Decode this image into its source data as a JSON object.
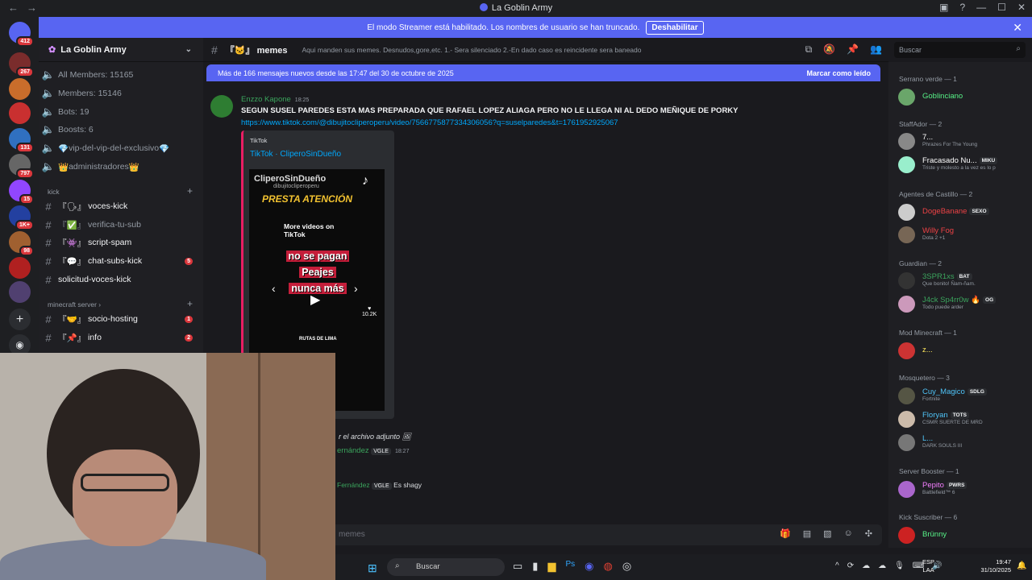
{
  "window": {
    "title": "La Goblin Army",
    "nav_back": "←",
    "nav_fwd": "→"
  },
  "banner": {
    "text": "El modo Streamer está habilitado. Los nombres de usuario se han truncado.",
    "button": "Deshabilitar",
    "close": "✕"
  },
  "servers": [
    {
      "badge": "412"
    },
    {
      "badge": "267"
    },
    {
      "badge": ""
    },
    {
      "badge": ""
    },
    {
      "badge": "131"
    },
    {
      "badge": "797"
    },
    {
      "badge": "15"
    },
    {
      "badge": "1K+"
    },
    {
      "badge": "98"
    },
    {
      "badge": ""
    },
    {
      "badge": ""
    }
  ],
  "sidebar": {
    "server_name": "La Goblin Army",
    "stats": [
      "All Members: 15165",
      "Members: 15146",
      "Bots: 19",
      "Boosts: 6"
    ],
    "special": [
      "vip-del-vip-del-exclusivo",
      "administradores"
    ],
    "cat_kick": "kick",
    "kick_channels": [
      {
        "name": "voces-kick",
        "prefix": "『🗣』",
        "bright": true,
        "badge": ""
      },
      {
        "name": "verifica-tu-sub",
        "prefix": "『✅』",
        "bright": false,
        "badge": ""
      },
      {
        "name": "script-spam",
        "prefix": "『👾』",
        "bright": true,
        "badge": ""
      },
      {
        "name": "chat-subs-kick",
        "prefix": "『💬』",
        "bright": true,
        "badge": "5"
      },
      {
        "name": "solicitud-voces-kick",
        "prefix": "",
        "bright": true,
        "badge": ""
      }
    ],
    "cat_minecraft": "minecraft server",
    "mc_channels": [
      {
        "name": "socio-hosting",
        "prefix": "『🤝』",
        "badge": "1"
      },
      {
        "name": "info",
        "prefix": "『📌』",
        "badge": "2"
      }
    ]
  },
  "channel": {
    "name": "memes",
    "prefix": "『🐱』",
    "topic": "Aqui manden sus memes. Desnudos,gore,etc. 1.- Sera silenciado 2.-En dado caso es reincidente sera baneado",
    "search_placeholder": "Buscar"
  },
  "new_messages": {
    "text": "Más de 166 mensajes nuevos desde las 17:47 del 30 de octubre de 2025",
    "action": "Marcar como leído"
  },
  "message": {
    "author": "Enzzo Kapone",
    "time": "18:25",
    "text": "SEGUN SUSEL PAREDES ESTA MAS PREPARADA QUE RAFAEL LOPEZ ALIAGA PERO NO LE LLEGA NI AL DEDO MEÑIQUE DE PORKY",
    "link": "https://www.tiktok.com/@dibujitocliperoperu/video/7566775877334306056?q=suselparedes&t=1761952925067",
    "embed_provider": "TikTok",
    "embed_title": "TikTok · CliperoSinDueño",
    "video": {
      "channel": "CliperoSinDueño",
      "handle": "dibujitocliperoperu",
      "headline": "PRESTA ATENCIÓN",
      "more": "More videos on TikTok",
      "caption": [
        "no se pagan",
        "Peajes",
        "nunca más"
      ],
      "likes": "10.2K",
      "rutas": "RUTAS DE LIMA"
    }
  },
  "attachment_text": "r el archivo adjunto",
  "reply1": {
    "author": "ernández",
    "tag": "VGLE",
    "time": "18:27"
  },
  "reply2": {
    "author": "Fernández",
    "tag": "VGLE",
    "text": "Es shagy"
  },
  "composer": {
    "placeholder": "memes"
  },
  "members": {
    "serrano": "Serrano verde — 1",
    "m_goblinciano": "Goblinciano",
    "staff": "StaffAdor — 2",
    "m_7": "7...",
    "m_7_status": "Phrazes For The Young",
    "m_fracasado": "Fracasado Nu...",
    "m_fracasado_tag": "MIKU",
    "m_fracasado_status": "Triste y molesto a la vez es lo p",
    "agentes": "Agentes de Castillo — 2",
    "m_doge": "DogeBanane",
    "m_doge_tag": "SEXO",
    "m_willy": "Willy Fog",
    "m_willy_status": "Dota 2 +1",
    "guardian": "Guardian — 2",
    "m_3spr": "3SPR1xs",
    "m_3spr_tag": "BAT",
    "m_3spr_status": "Que bonito! Ñam-ñam.",
    "m_j4ck": "J4ck Sp4rr0w",
    "m_j4ck_tag": "OG",
    "m_j4ck_status": "Todo puede arder",
    "modmc": "Mod Minecraft — 1",
    "m_z": "z...",
    "mosquetero": "Mosquetero — 3",
    "m_cuy": "Cuy_Magico",
    "m_cuy_tag": "SDLG",
    "m_cuy_status": "Fortnite",
    "m_floryan": "Floryan",
    "m_floryan_tag": "TOTS",
    "m_floryan_status": "CSMR SUERTE DE MRD",
    "m_l": "L...",
    "m_l_status": "DARK SOULS III",
    "booster": "Server Booster — 1",
    "m_pepito": "Pepito",
    "m_pepito_tag": "PWRS",
    "m_pepito_status": "Battlefield™ 6",
    "kicksub": "Kick Suscriber — 6",
    "m_brunny": "Brünny"
  },
  "taskbar": {
    "search": "Buscar",
    "lang1": "ESP",
    "lang2": "LAA",
    "time": "19:47",
    "date": "31/10/2025"
  }
}
